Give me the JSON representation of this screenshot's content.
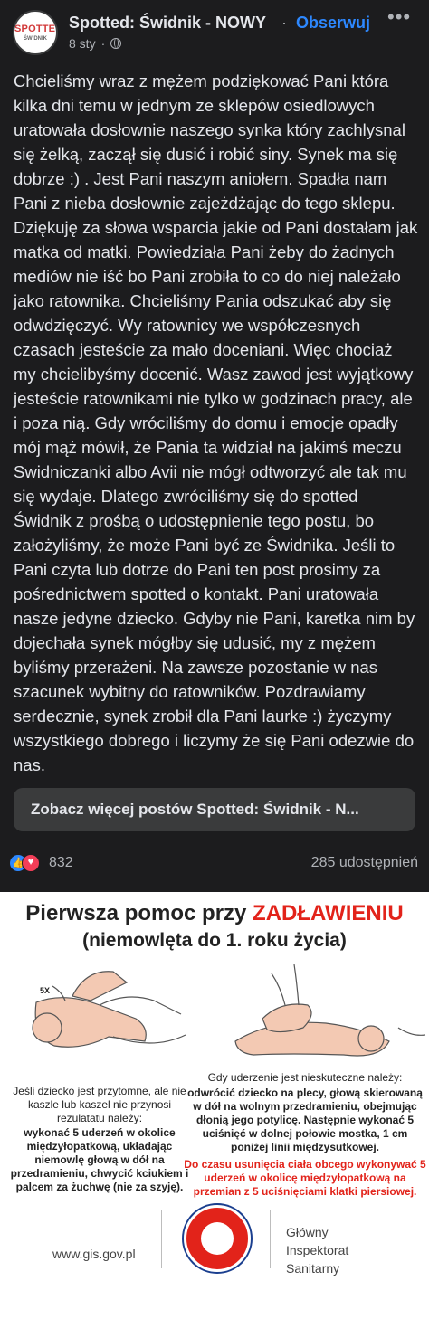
{
  "header": {
    "page_name": "Spotted: Świdnik - NOWY",
    "separator": "·",
    "follow_label": "Obserwuj",
    "more_label": "•••",
    "date": "8 sty",
    "visibility_icon": "globe-icon",
    "avatar": {
      "top": "SPOTTED",
      "bottom": "ŚWIDNIK"
    }
  },
  "post": {
    "text": "Chcieliśmy wraz z mężem podziękować Pani która kilka dni temu w jednym ze sklepów osiedlowych uratowała dosłownie naszego synka który zachlysnal się żelką, zaczął się dusić i robić siny. Synek ma się dobrze :) . Jest Pani naszym aniołem. Spadła nam Pani z nieba dosłownie  zajeżdżając do tego sklepu. Dziękuję za słowa wsparcia jakie od Pani dostałam jak matka od matki. Powiedziała Pani żeby do żadnych mediów nie iść bo Pani zrobiła to co do niej należało jako ratownika. Chcieliśmy Pania odszukać aby się odwdzięczyć. Wy ratownicy we współczesnych czasach jesteście za mało doceniani.  Więc chociaż my chcielibyśmy docenić. Wasz zawod jest wyjątkowy jesteście ratownikami nie tylko w godzinach pracy, ale i poza nią. Gdy wróciliśmy do domu i emocje opadły mój mąż mówił, że Pania ta widział na jakimś meczu Swidniczanki albo Avii nie mógł odtworzyć ale tak mu się wydaje. Dlatego zwróciliśmy się do spotted Świdnik z prośbą o udostępnienie tego postu, bo założyliśmy, że może Pani być ze Świdnika. Jeśli to Pani czyta lub dotrze do Pani ten post prosimy za pośrednictwem spotted o kontakt. Pani uratowała nasze jedyne dziecko. Gdyby nie Pani, karetka nim by dojechała synek mógłby się udusić, my z mężem byliśmy przerażeni. Na zawsze pozostanie w nas szacunek wybitny do ratowników. Pozdrawiamy serdecznie, synek zrobił dla Pani laurke :) życzymy wszystkiego dobrego i liczymy że się Pani odezwie do nas."
  },
  "see_more_label": "Zobacz więcej postów Spotted: Świdnik - N...",
  "reactions": {
    "like_icon": "thumbs-up-icon",
    "love_icon": "heart-icon",
    "count": "832",
    "shares": "285 udostępnień"
  },
  "infographic": {
    "title_plain": "Pierwsza pomoc przy ",
    "title_red": "ZADŁAWIENIU",
    "subtitle": "(niemowlęta do 1. roku życia)",
    "label_5x": "5X",
    "left_intro": "Jeśli dziecko jest przytomne, ale nie kaszle lub kaszel nie przynosi rezulatatu należy:",
    "left_bold": "wykonać 5 uderzeń w okolice międzyłopatkową, układając niemowlę głową w dół na przedramieniu, chwycić kciukiem i palcem za żuchwę (nie za szyję).",
    "right_intro": "Gdy uderzenie jest nieskuteczne należy:",
    "right_bold": "odwrócić dziecko na plecy, głową skierowaną w dół na wolnym przedramieniu, obejmując dłonią jego potylicę. Następnie wykonać 5 uciśnięć w dolnej połowie mostka, 1 cm poniżej linii międzysutkowej.",
    "right_red": "Do czasu usunięcia ciała obcego wykonywać 5 uderzeń w okolicę międzyłopatkową na przemian z 5 uciśnięciami klatki piersiowej.",
    "footer_url": "www.gis.gov.pl",
    "footer_name": "Główny\nInspektorat\nSanitarny",
    "seal_text_top": "PAŃSTWOWA",
    "seal_text_bottom": "INSPEKCJA SANITARNA",
    "accent_red": "#e2231a"
  },
  "colors": {
    "background": "#1c1c1e",
    "link_blue": "#2d88ff",
    "button_bg": "#3a3b3c"
  }
}
